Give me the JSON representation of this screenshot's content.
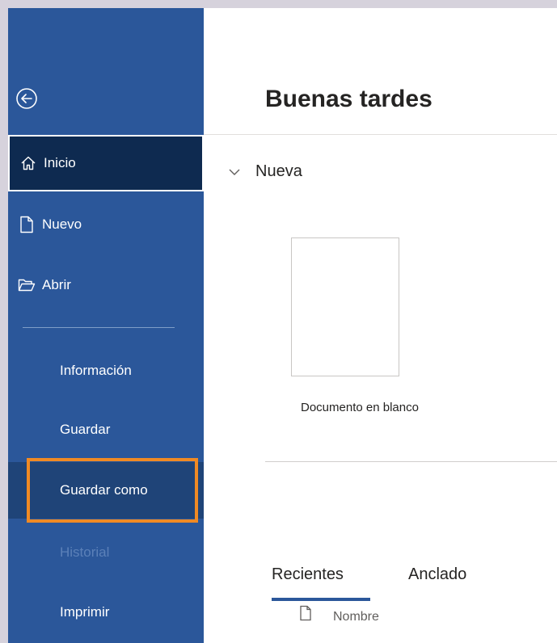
{
  "sidebar": {
    "back_icon": "back-arrow-circle-icon",
    "items": [
      {
        "label": "Inicio",
        "icon": "home-icon"
      },
      {
        "label": "Nuevo",
        "icon": "new-document-icon"
      },
      {
        "label": "Abrir",
        "icon": "open-folder-icon"
      },
      {
        "label": "Información"
      },
      {
        "label": "Guardar"
      },
      {
        "label": "Guardar como"
      },
      {
        "label": "Historial"
      },
      {
        "label": "Imprimir"
      }
    ]
  },
  "main": {
    "greeting": "Buenas tardes",
    "section_title": "Nueva",
    "template_label": "Documento en blanco",
    "tabs": [
      {
        "label": "Recientes"
      },
      {
        "label": "Anclado"
      }
    ],
    "column_header": "Nombre"
  },
  "colors": {
    "sidebar_bg": "#2b579a",
    "selected_bg": "#0e2a50",
    "highlight": "#f08a24"
  }
}
